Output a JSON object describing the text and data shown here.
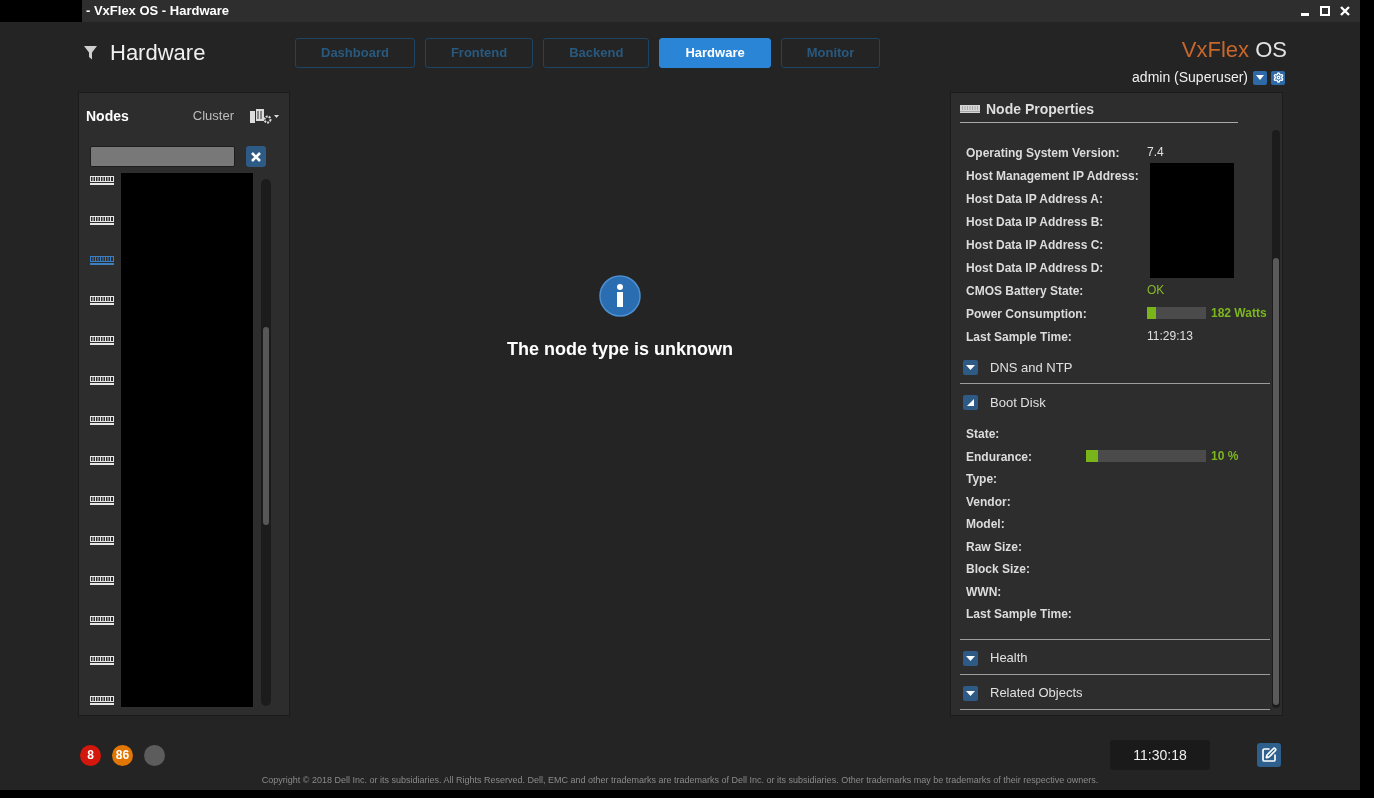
{
  "window": {
    "title": "- VxFlex OS - Hardware"
  },
  "header": {
    "title": "Hardware",
    "tabs": [
      {
        "label": "Dashboard",
        "selected": false
      },
      {
        "label": "Frontend",
        "selected": false
      },
      {
        "label": "Backend",
        "selected": false
      },
      {
        "label": "Hardware",
        "selected": true
      },
      {
        "label": "Monitor",
        "selected": false
      }
    ],
    "brand": {
      "name": "VxFlex",
      "suffix": "OS"
    },
    "user": "admin (Superuser)"
  },
  "nodes_panel": {
    "title": "Nodes",
    "cluster_label": "Cluster",
    "nodes": [
      {
        "selected": false
      },
      {
        "selected": false
      },
      {
        "selected": true
      },
      {
        "selected": false
      },
      {
        "selected": false
      },
      {
        "selected": false
      },
      {
        "selected": false
      },
      {
        "selected": false
      },
      {
        "selected": false
      },
      {
        "selected": false
      },
      {
        "selected": false
      },
      {
        "selected": false
      },
      {
        "selected": false
      },
      {
        "selected": false
      }
    ]
  },
  "content": {
    "message": "The node type is unknown"
  },
  "properties_panel": {
    "title": "Node Properties",
    "rows": [
      {
        "label": "Operating System Version:",
        "kind": "text",
        "value": "7.4"
      },
      {
        "label": "Host Management IP Address:",
        "kind": "redacted"
      },
      {
        "label": "Host Data IP Address A:",
        "kind": "redacted"
      },
      {
        "label": "Host Data IP Address B:",
        "kind": "redacted"
      },
      {
        "label": "Host Data IP Address C:",
        "kind": "redacted"
      },
      {
        "label": "Host Data IP Address D:",
        "kind": "redacted"
      },
      {
        "label": "CMOS Battery State:",
        "kind": "status",
        "value": "OK"
      },
      {
        "label": "Power Consumption:",
        "kind": "meter",
        "level": 0.15,
        "reading": "182 Watts"
      },
      {
        "label": "Last Sample Time:",
        "kind": "text",
        "value": "11:29:13"
      }
    ],
    "sections": [
      {
        "title": "DNS and NTP",
        "expanded": false
      },
      {
        "title": "Boot Disk",
        "expanded": true,
        "rows": [
          {
            "label": "State:",
            "kind": "blank"
          },
          {
            "label": "Endurance:",
            "kind": "meter",
            "level": 0.1,
            "reading": "10 %"
          },
          {
            "label": "Type:",
            "kind": "blank"
          },
          {
            "label": "Vendor:",
            "kind": "blank"
          },
          {
            "label": "Model:",
            "kind": "blank"
          },
          {
            "label": "Raw Size:",
            "kind": "blank"
          },
          {
            "label": "Block Size:",
            "kind": "blank"
          },
          {
            "label": "WWN:",
            "kind": "blank"
          },
          {
            "label": "Last Sample Time:",
            "kind": "blank"
          }
        ]
      },
      {
        "title": "Health",
        "expanded": false
      },
      {
        "title": "Related Objects",
        "expanded": false
      }
    ]
  },
  "footer": {
    "alerts": [
      {
        "count": "8",
        "color": "#d4170c"
      },
      {
        "count": "86",
        "color": "#e27605"
      },
      {
        "color": "#5c5c5c"
      }
    ],
    "time": "11:30:18",
    "copyright": "Copyright © 2018 Dell Inc. or its subsidiaries. All Rights Reserved. Dell, EMC and other trademarks are trademarks of Dell Inc. or its subsidiaries. Other trademarks may be trademarks of their respective owners."
  }
}
